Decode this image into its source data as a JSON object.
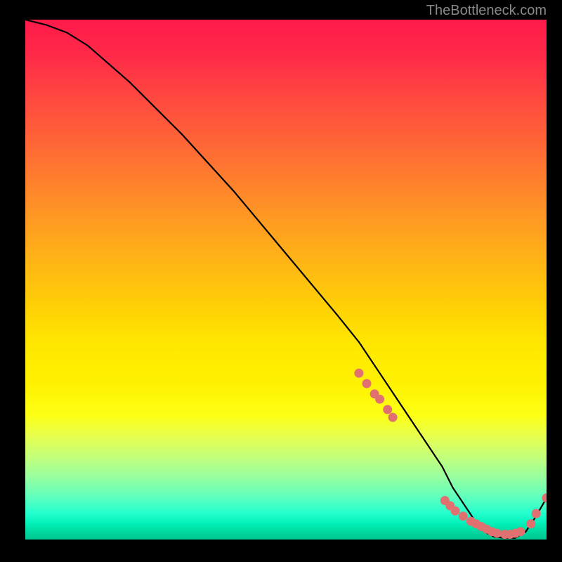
{
  "watermark": "TheBottleneck.com",
  "chart_data": {
    "type": "line",
    "title": "",
    "xlabel": "",
    "ylabel": "",
    "xlim": [
      0,
      100
    ],
    "ylim": [
      0,
      100
    ],
    "x": [
      0,
      4,
      8,
      12,
      20,
      30,
      40,
      50,
      60,
      64,
      68,
      72,
      76,
      80,
      82,
      84,
      86,
      88,
      90,
      92,
      94,
      96,
      98,
      100
    ],
    "values": [
      100,
      99,
      97.5,
      95,
      88,
      78,
      67,
      55,
      43,
      38,
      32,
      26,
      20,
      14,
      10,
      7,
      4,
      1.5,
      0.5,
      0.3,
      0.3,
      1.5,
      4.5,
      8
    ],
    "scatter_points": {
      "x": [
        64,
        65.5,
        67,
        68,
        69.5,
        70.5,
        80.5,
        81.5,
        82.5,
        84,
        85.5,
        86.5,
        87.5,
        88.5,
        89.5,
        90.5,
        92,
        93,
        94,
        95,
        97,
        98,
        100
      ],
      "y": [
        32,
        30,
        28,
        27,
        25,
        23.5,
        7.5,
        6.5,
        5.5,
        4.5,
        3.5,
        3.0,
        2.5,
        2.0,
        1.5,
        1.2,
        1.0,
        1.0,
        1.2,
        1.5,
        3.0,
        5.0,
        8.0
      ]
    },
    "gradient_colors": {
      "top": "#ff1a4a",
      "mid_upper": "#ffb018",
      "mid": "#ffe600",
      "mid_lower": "#c4ff7a",
      "bottom": "#00c890"
    },
    "marker_color": "#e17070"
  }
}
